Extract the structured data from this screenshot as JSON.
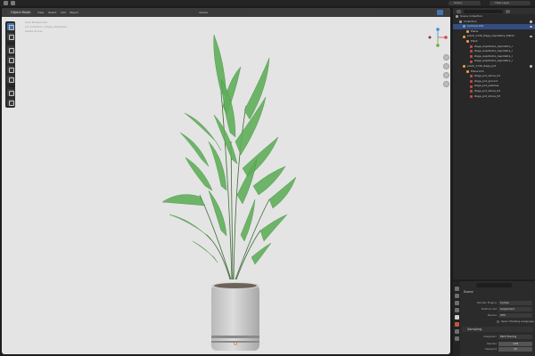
{
  "topbar": {
    "scene_label": "Scene",
    "view_layer_label": "View Layer"
  },
  "viewport_header": {
    "mode": "Object Mode",
    "menus": [
      "View",
      "Select",
      "Add",
      "Object"
    ],
    "pivot_label": "Global"
  },
  "hud": [
    "User Perspective",
    "(1) Collection | Zaga_Aspidistra",
    "Saved Scene"
  ],
  "outliner": {
    "rows": [
      {
        "label": "Scene Collection",
        "indent": 0,
        "icon": "collection-icon",
        "color": "#9a9a9a",
        "selected": false
      },
      {
        "label": "Collection",
        "indent": 1,
        "icon": "collection-icon",
        "color": "#9a9a9a",
        "selected": false
      },
      {
        "label": "Camera.002",
        "indent": 2,
        "icon": "camera-icon",
        "color": "#6a9ad1",
        "selected": true
      },
      {
        "label": "Plane",
        "indent": 3,
        "icon": "mesh-icon",
        "color": "#e89a3c",
        "selected": false
      },
      {
        "label": "plant_1139_Zaga_Aspidistra_Elatior",
        "indent": 2,
        "icon": "object-icon",
        "color": "#e89a3c",
        "selected": false
      },
      {
        "label": "Plant",
        "indent": 3,
        "icon": "mesh-icon",
        "color": "#e89a3c",
        "selected": false
      },
      {
        "label": "Zaga_Aspidistra_Aspidistra_l",
        "indent": 4,
        "icon": "material-icon",
        "color": "#c24a4a",
        "selected": false
      },
      {
        "label": "Zaga_Aspidistra_Aspidistra_l",
        "indent": 4,
        "icon": "material-icon",
        "color": "#c24a4a",
        "selected": false
      },
      {
        "label": "Zaga_Aspidistra_Aspidistra_l",
        "indent": 4,
        "icon": "material-icon",
        "color": "#c24a4a",
        "selected": false
      },
      {
        "label": "Zaga_Aspidistra_Aspidistra_l",
        "indent": 4,
        "icon": "material-icon",
        "color": "#c24a4a",
        "selected": false
      },
      {
        "label": "plant_1139_Zaga_pot",
        "indent": 2,
        "icon": "object-icon",
        "color": "#e89a3c",
        "selected": false
      },
      {
        "label": "Plane.011",
        "indent": 3,
        "icon": "mesh-icon",
        "color": "#e89a3c",
        "selected": false
      },
      {
        "label": "Zaga_pot_stone_01",
        "indent": 4,
        "icon": "material-icon",
        "color": "#c24a4a",
        "selected": false
      },
      {
        "label": "Zaga_pot_ground",
        "indent": 4,
        "icon": "material-icon",
        "color": "#c24a4a",
        "selected": false
      },
      {
        "label": "Zaga_pot_pebbles",
        "indent": 4,
        "icon": "material-icon",
        "color": "#c24a4a",
        "selected": false
      },
      {
        "label": "Zaga_pot_stone_02",
        "indent": 4,
        "icon": "material-icon",
        "color": "#c24a4a",
        "selected": false
      },
      {
        "label": "Zaga_pot_stone_03",
        "indent": 4,
        "icon": "material-icon",
        "color": "#c24a4a",
        "selected": false
      }
    ]
  },
  "properties": {
    "title": "Scene",
    "render_engine": {
      "label": "Render Engine",
      "value": "Cycles"
    },
    "feature_set": {
      "label": "Feature Set",
      "value": "Supported"
    },
    "device": {
      "label": "Device",
      "value": "CPU"
    },
    "osl_label": "Open Shading Language",
    "sampling_section": "Sampling",
    "integrator": {
      "label": "Integrator",
      "value": "Path Tracing"
    },
    "render_samples": {
      "label": "Render",
      "value": "128"
    },
    "viewport_samples": {
      "label": "Viewport",
      "value": "32"
    }
  },
  "colors": {
    "accent": "#4772b3",
    "leaf": "#5fae5a",
    "pot": "#c9c9c9",
    "viewport_bg": "#e4e4e4"
  }
}
